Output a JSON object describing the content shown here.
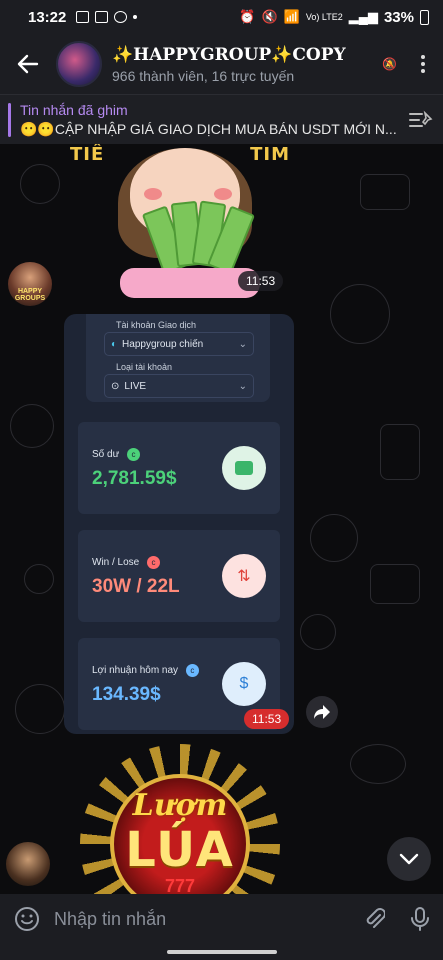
{
  "status_bar": {
    "time": "13:22",
    "network": "Vo) LTE2",
    "battery": "33%"
  },
  "header": {
    "title": "✨HAPPYGROUP✨COPY",
    "subtitle": "966 thành viên, 16 trực tuyến"
  },
  "pinned": {
    "label": "Tin nhắn đã ghim",
    "message": "😶😶CẬP NHẬP GIÁ GIAO DỊCH MUA BÁN USDT MỚI N..."
  },
  "messages": {
    "sticker_text_left": "TIỀ",
    "sticker_text_right": "TIM",
    "sticker_time": "11:53",
    "sender_tag": "HAPPY GROUPS",
    "image_time": "11:53",
    "screenshot": {
      "account_label": "Tài khoản Giao dịch",
      "account_value": "Happygroup chiến",
      "type_label": "Loại tài khoản",
      "type_value": "LIVE",
      "balance_label": "Số dư",
      "balance_value": "2,781.59$",
      "winlose_label": "Win / Lose",
      "winlose_value": "30W / 22L",
      "profit_label": "Lợi nhuận hôm nay",
      "profit_value": "134.39$"
    },
    "bottom_sticker_line1": "Lượm",
    "bottom_sticker_line2": "LÚA",
    "bottom_sticker_line3": "777"
  },
  "input": {
    "placeholder": "Nhập tin nhắn"
  },
  "colors": {
    "accent": "#a578e8",
    "balance": "#4cd17a",
    "winlose": "#ff8a7a",
    "profit": "#6ab8ff"
  }
}
